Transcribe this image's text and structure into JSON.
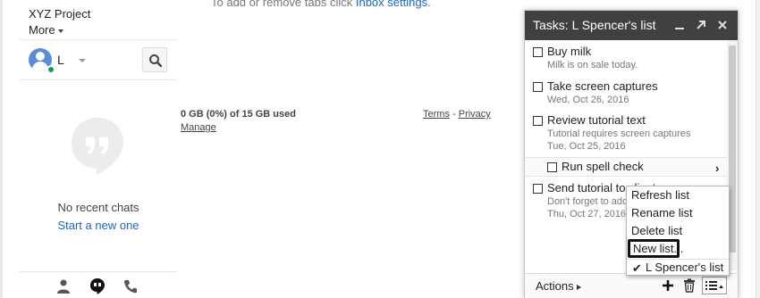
{
  "sidebar": {
    "project_name": "XYZ Project",
    "more_label": "More",
    "user_initial": "L",
    "no_chats_text": "No recent chats",
    "start_new_label": "Start a new one"
  },
  "main": {
    "top_note_prefix": "To add or remove tabs click ",
    "top_note_link": "Inbox settings",
    "top_note_suffix": ".",
    "storage_text": "0 GB (0%) of 15 GB used",
    "manage_label": "Manage",
    "terms_label": "Terms",
    "footer_sep": " - ",
    "privacy_label": "Privacy"
  },
  "tasks": {
    "title": "Tasks: L Spencer's list",
    "items": [
      {
        "title": "Buy milk",
        "note": "Milk is on sale today.",
        "date": ""
      },
      {
        "title": "Take screen captures",
        "note": "",
        "date": "Wed, Oct 26, 2016"
      },
      {
        "title": "Review tutorial text",
        "note": "Tutorial requires screen captures",
        "date": "Tue, Oct 25, 2016"
      },
      {
        "title": "Run spell check",
        "note": "",
        "date": ""
      },
      {
        "title": "Send tutorial to client",
        "note": "Don't forget to add",
        "date": "Thu, Oct 27, 2016"
      }
    ],
    "actions_label": "Actions"
  },
  "list_menu": {
    "items": [
      "Refresh list",
      "Rename list",
      "Delete list",
      "New list..."
    ],
    "current_list": "L Spencer's list",
    "check_glyph": "✔"
  },
  "icons": {
    "header": [
      "minimize-icon",
      "popout-icon",
      "close-icon"
    ],
    "footer": [
      "add-task-icon",
      "trash-icon",
      "list-switch-icon"
    ],
    "sidebar_tabs": [
      "contacts-icon",
      "hangouts-icon",
      "phone-icon"
    ]
  },
  "colors": {
    "link": "#1a65c7",
    "tasks_header_bg": "#404040",
    "online": "#0f9d58",
    "avatar": "#5b8dd6"
  }
}
